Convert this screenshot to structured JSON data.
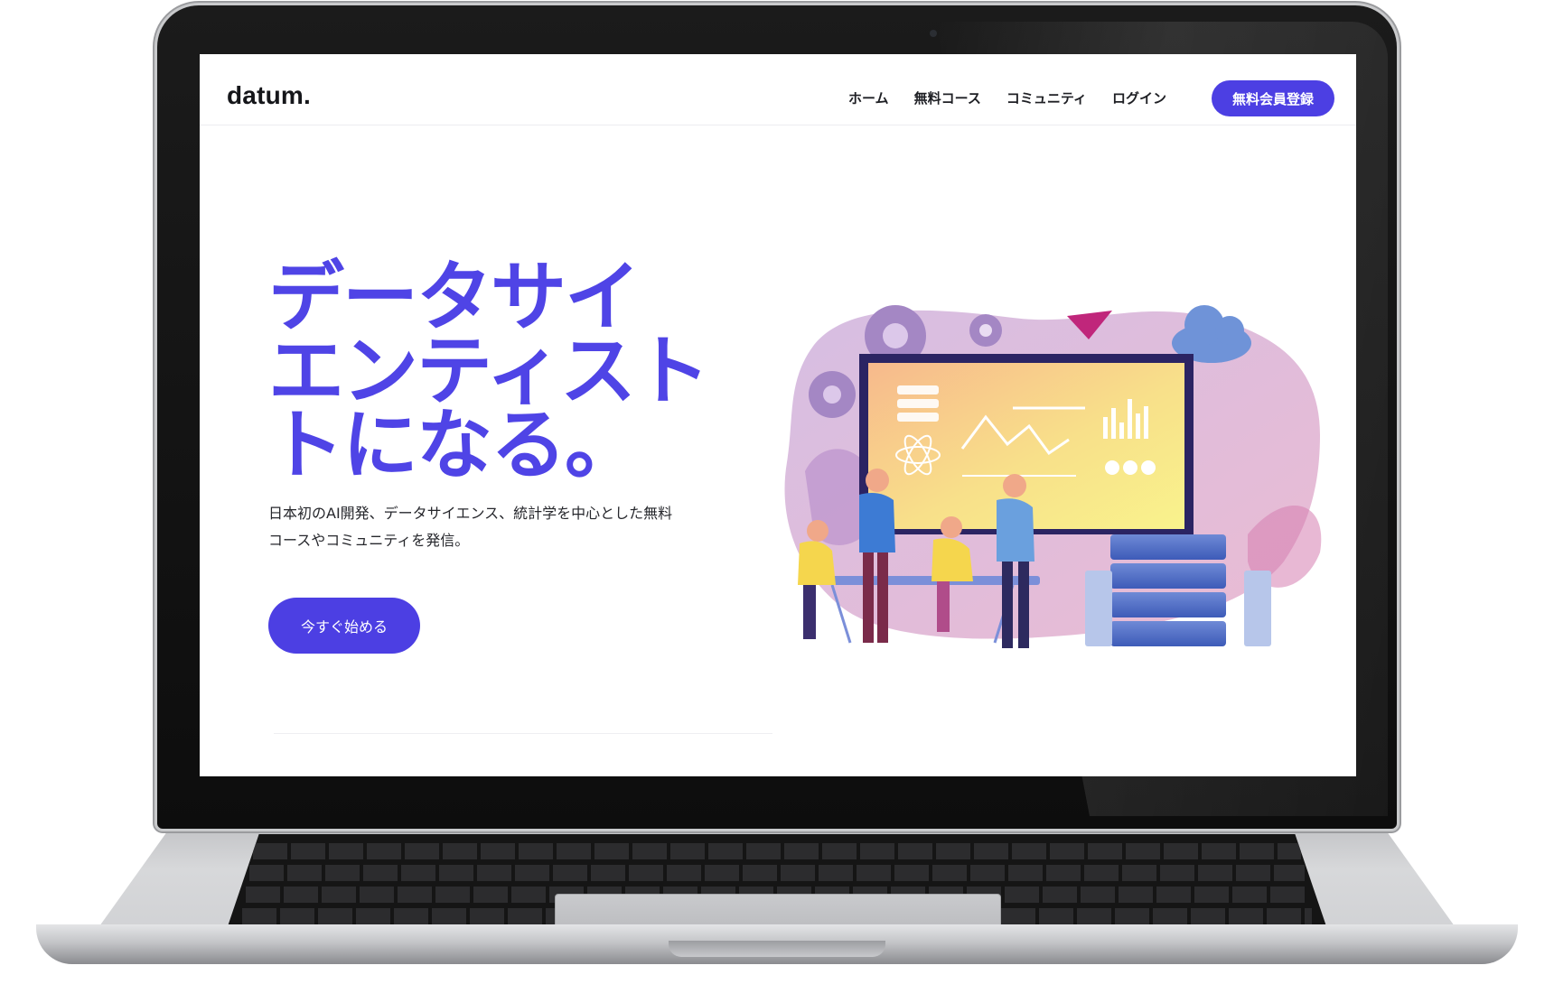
{
  "site": {
    "logo": "datum.",
    "nav": [
      "ホーム",
      "無料コース",
      "コミュニティ",
      "ログイン"
    ],
    "cta": "無料会員登録"
  },
  "hero": {
    "title_lines": [
      "データサイ",
      "エンティスト",
      "トになる。"
    ],
    "description": "日本初のAI開発、データサイエンス、統計学を中心とした無料コースやコミュニティを発信。",
    "button": "今すぐ始める"
  },
  "colors": {
    "accent": "#4c3fe3",
    "title": "#4f44e6",
    "text": "#26272c"
  },
  "icons": [
    "gear-icon",
    "paper-plane-icon",
    "cloud-icon",
    "atom-icon",
    "bar-chart-icon",
    "line-chart-icon"
  ]
}
